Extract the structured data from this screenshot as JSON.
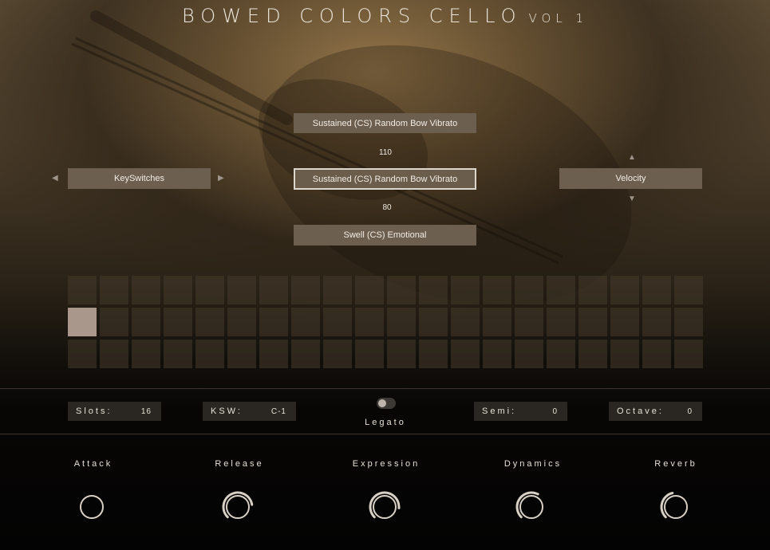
{
  "title": {
    "main": "BOWED COLORS CELLO",
    "vol": "VOL 1"
  },
  "articulations": {
    "top": "Sustained (CS) Random Bow Vibrato",
    "top_value": "110",
    "selected": "Sustained (CS) Random Bow Vibrato",
    "bottom_value": "80",
    "bottom": "Swell (CS) Emotional"
  },
  "left_selector": {
    "label": "KeySwitches",
    "prev_icon": "triangle-left",
    "next_icon": "triangle-right"
  },
  "right_selector": {
    "label": "Velocity",
    "up_icon": "triangle-up",
    "down_icon": "triangle-down"
  },
  "pads": {
    "rows": 3,
    "columns": 20,
    "active_row": 1,
    "active_col": 0,
    "active_color": "#a8978a"
  },
  "settings": {
    "slots": {
      "label": "Slots:",
      "value": "16"
    },
    "ksw": {
      "label": "KSW:",
      "value": "C-1"
    },
    "legato": {
      "label": "Legato",
      "on": false
    },
    "semi": {
      "label": "Semi:",
      "value": "0"
    },
    "octave": {
      "label": "Octave:",
      "value": "0"
    }
  },
  "knobs": [
    {
      "label": "Attack",
      "level": 0.0
    },
    {
      "label": "Release",
      "level": 0.8
    },
    {
      "label": "Expression",
      "level": 0.85
    },
    {
      "label": "Dynamics",
      "level": 0.6
    },
    {
      "label": "Reverb",
      "level": 0.45
    }
  ],
  "colors": {
    "accent": "#d8d0c4",
    "button_bg": "#6d5f4f",
    "field_bg": "#2a2722"
  }
}
